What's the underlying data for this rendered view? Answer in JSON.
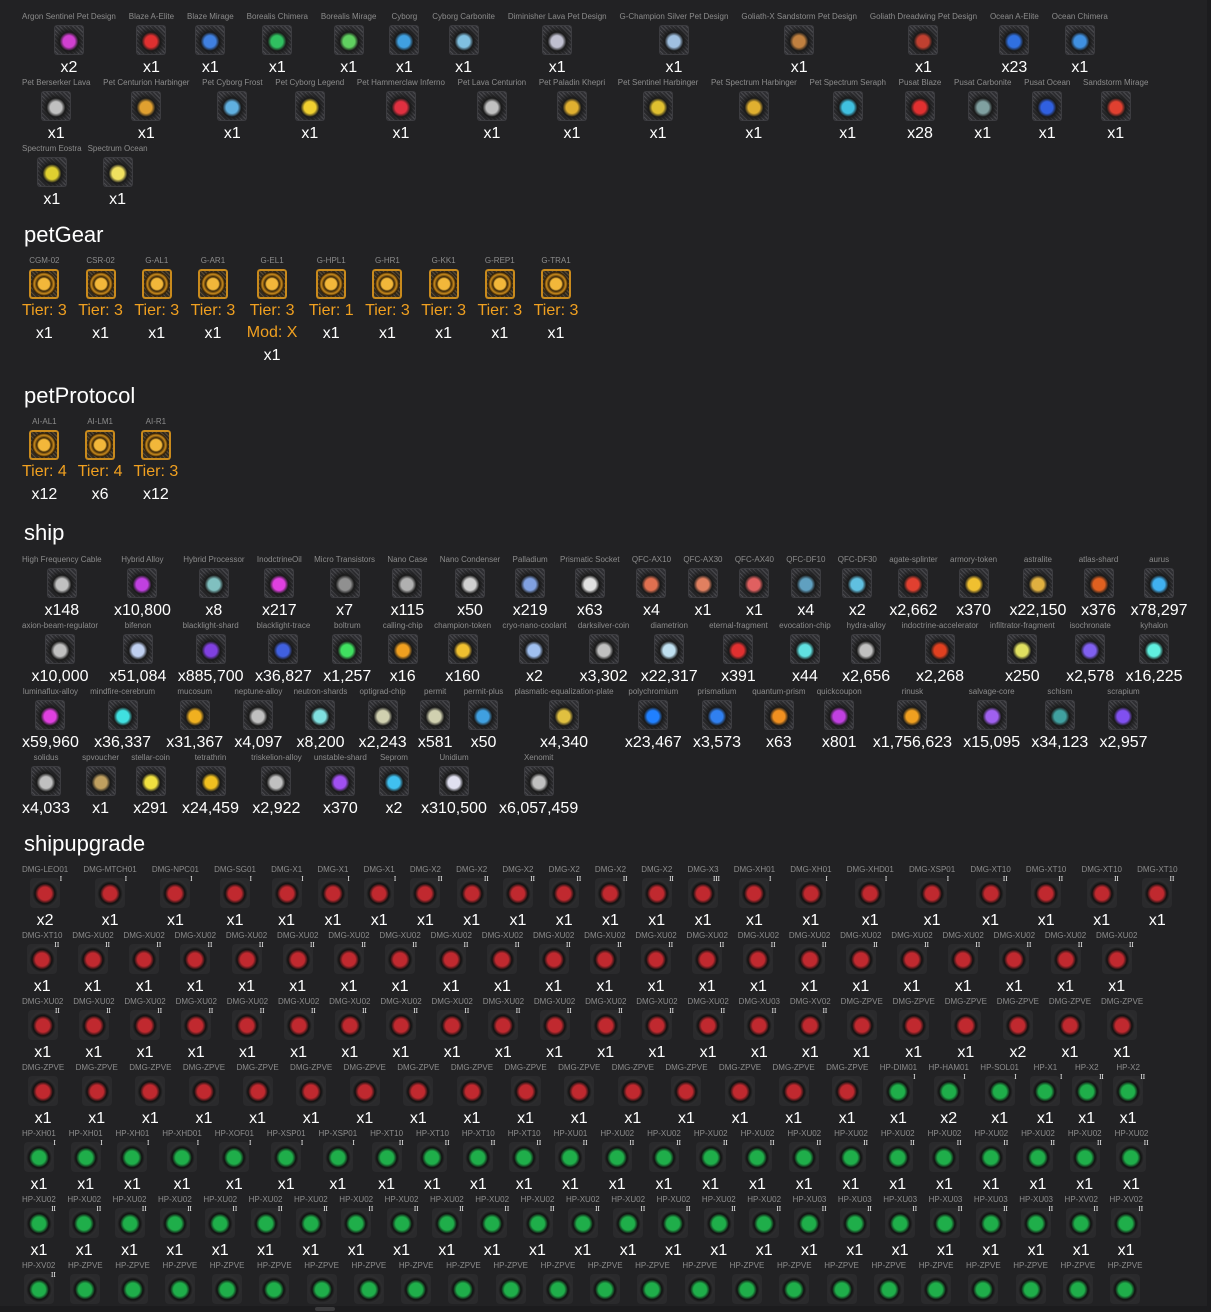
{
  "colors": {
    "background": "#222224",
    "text": "#ffffff",
    "label": "#8c8c8c",
    "tier": "#f0a020",
    "dmg": "#c0292f",
    "hp": "#1fae4a",
    "gear": "#f2b73a"
  },
  "headings": {
    "petGear": "petGear",
    "petProtocol": "petProtocol",
    "ship": "ship",
    "shipupgrade": "shipupgrade"
  },
  "pet_designs": [
    [
      [
        "Argon Sentinel Pet Design",
        "x2"
      ],
      [
        "Blaze A-Elite",
        "x1"
      ],
      [
        "Blaze Mirage",
        "x1"
      ],
      [
        "Borealis Chimera",
        "x1"
      ],
      [
        "Borealis Mirage",
        "x1"
      ],
      [
        "Cyborg",
        "x1"
      ],
      [
        "Cyborg Carbonite",
        "x1"
      ],
      [
        "Diminisher Lava Pet Design",
        "x1"
      ],
      [
        "G-Champion Silver Pet Design",
        "x1"
      ],
      [
        "Goliath-X Sandstorm Pet Design",
        "x1"
      ],
      [
        "Goliath Dreadwing Pet Design",
        "x1"
      ],
      [
        "Ocean A-Elite",
        "x23"
      ],
      [
        "Ocean Chimera",
        "x1"
      ]
    ],
    [
      [
        "Pet Berserker Lava",
        "x1"
      ],
      [
        "Pet Centurion Harbinger",
        "x1"
      ],
      [
        "Pet Cyborg Frost",
        "x1"
      ],
      [
        "Pet Cyborg Legend",
        "x1"
      ],
      [
        "Pet Hammerclaw Inferno",
        "x1"
      ],
      [
        "Pet Lava Centurion",
        "x1"
      ],
      [
        "Pet Paladin Khepri",
        "x1"
      ],
      [
        "Pet Sentinel Harbinger",
        "x1"
      ],
      [
        "Pet Spectrum Harbinger",
        "x1"
      ],
      [
        "Pet Spectrum Seraph",
        "x1"
      ],
      [
        "Pusat Blaze",
        "x28"
      ],
      [
        "Pusat Carbonite",
        "x1"
      ],
      [
        "Pusat Ocean",
        "x1"
      ],
      [
        "Sandstorm Mirage",
        "x1"
      ]
    ],
    [
      [
        "Spectrum Eostra",
        "x1"
      ],
      [
        "Spectrum Ocean",
        "x1"
      ]
    ]
  ],
  "pet_gear": [
    [
      "CGM-02",
      "Tier: 3",
      "x1"
    ],
    [
      "CSR-02",
      "Tier: 3",
      "x1"
    ],
    [
      "G-AL1",
      "Tier: 3",
      "x1"
    ],
    [
      "G-AR1",
      "Tier: 3",
      "x1"
    ],
    [
      "G-EL1",
      "Tier: 3",
      "Mod: X",
      "x1"
    ],
    [
      "G-HPL1",
      "Tier: 1",
      "x1"
    ],
    [
      "G-HR1",
      "Tier: 3",
      "x1"
    ],
    [
      "G-KK1",
      "Tier: 3",
      "x1"
    ],
    [
      "G-REP1",
      "Tier: 3",
      "x1"
    ],
    [
      "G-TRA1",
      "Tier: 3",
      "x1"
    ]
  ],
  "pet_protocol": [
    [
      "AI-AL1",
      "Tier: 4",
      "x12"
    ],
    [
      "AI-LM1",
      "Tier: 4",
      "x6"
    ],
    [
      "AI-R1",
      "Tier: 3",
      "x12"
    ]
  ],
  "ship": [
    [
      [
        "High Frequency Cable",
        "x148"
      ],
      [
        "Hybrid Alloy",
        "x10,800"
      ],
      [
        "Hybrid Processor",
        "x8"
      ],
      [
        "InodctrineOil",
        "x217"
      ],
      [
        "Micro Transistors",
        "x7"
      ],
      [
        "Nano Case",
        "x115"
      ],
      [
        "Nano Condenser",
        "x50"
      ],
      [
        "Palladium",
        "x219"
      ],
      [
        "Prismatic Socket",
        "x63"
      ],
      [
        "QFC-AX10",
        "x4"
      ],
      [
        "QFC-AX30",
        "x1"
      ],
      [
        "QFC-AX40",
        "x1"
      ],
      [
        "QFC-DF10",
        "x4"
      ],
      [
        "QFC-DF30",
        "x2"
      ],
      [
        "agate-splinter",
        "x2,662"
      ],
      [
        "armory-token",
        "x370"
      ],
      [
        "astralite",
        "x22,150"
      ],
      [
        "atlas-shard",
        "x376"
      ],
      [
        "aurus",
        "x78,297"
      ]
    ],
    [
      [
        "axion-beam-regulator",
        "x10,000"
      ],
      [
        "bifenon",
        "x51,084"
      ],
      [
        "blacklight-shard",
        "x885,700"
      ],
      [
        "blacklight-trace",
        "x36,827"
      ],
      [
        "boltrum",
        "x1,257"
      ],
      [
        "calling-chip",
        "x16"
      ],
      [
        "champion-token",
        "x160"
      ],
      [
        "cryo-nano-coolant",
        "x2"
      ],
      [
        "darksilver-coin",
        "x3,302"
      ],
      [
        "diametrion",
        "x22,317"
      ],
      [
        "eternal-fragment",
        "x391"
      ],
      [
        "evocation-chip",
        "x44"
      ],
      [
        "hydra-alloy",
        "x2,656"
      ],
      [
        "indoctrine-accelerator",
        "x2,268"
      ],
      [
        "infiltrator-fragment",
        "x250"
      ],
      [
        "isochronate",
        "x2,578"
      ],
      [
        "kyhalon",
        "x16,225"
      ]
    ],
    [
      [
        "luminaflux-alloy",
        "x59,960"
      ],
      [
        "mindfire-cerebrum",
        "x36,337"
      ],
      [
        "mucosum",
        "x31,367"
      ],
      [
        "neptune-alloy",
        "x4,097"
      ],
      [
        "neutron-shards",
        "x8,200"
      ],
      [
        "optigrad-chip",
        "x2,243"
      ],
      [
        "permit",
        "x581"
      ],
      [
        "permit-plus",
        "x50"
      ],
      [
        "plasmatic-equalization-plate",
        "x4,340"
      ],
      [
        "polychromium",
        "x23,467"
      ],
      [
        "prismatium",
        "x3,573"
      ],
      [
        "quantum-prism",
        "x63"
      ],
      [
        "quickcoupon",
        "x801"
      ],
      [
        "rinusk",
        "x1,756,623"
      ],
      [
        "salvage-core",
        "x15,095"
      ],
      [
        "schism",
        "x34,123"
      ],
      [
        "scrapium",
        "x2,957"
      ]
    ],
    [
      [
        "solidus",
        "x4,033"
      ],
      [
        "spvoucher",
        "x1"
      ],
      [
        "stellar-coin",
        "x291"
      ],
      [
        "tetrathrin",
        "x24,459"
      ],
      [
        "triskelion-alloy",
        "x2,922"
      ],
      [
        "unstable-shard",
        "x370"
      ],
      [
        "Seprom",
        "x2"
      ],
      [
        "Unidium",
        "x310,500"
      ],
      [
        "Xenomit",
        "x6,057,459"
      ]
    ]
  ],
  "shipupgrade": [
    [
      [
        "DMG-LEO01",
        "x2"
      ],
      [
        "DMG-MTCH01",
        "x1"
      ],
      [
        "DMG-NPC01",
        "x1"
      ],
      [
        "DMG-SG01",
        "x1"
      ],
      [
        "DMG-X1",
        "x1"
      ],
      [
        "DMG-X1",
        "x1"
      ],
      [
        "DMG-X1",
        "x1"
      ],
      [
        "DMG-X2",
        "x1"
      ],
      [
        "DMG-X2",
        "x1"
      ],
      [
        "DMG-X2",
        "x1"
      ],
      [
        "DMG-X2",
        "x1"
      ],
      [
        "DMG-X2",
        "x1"
      ],
      [
        "DMG-X2",
        "x1"
      ],
      [
        "DMG-X3",
        "x1"
      ],
      [
        "DMG-XH01",
        "x1"
      ],
      [
        "DMG-XH01",
        "x1"
      ],
      [
        "DMG-XHD01",
        "x1"
      ],
      [
        "DMG-XSP01",
        "x1"
      ],
      [
        "DMG-XT10",
        "x1"
      ],
      [
        "DMG-XT10",
        "x1"
      ],
      [
        "DMG-XT10",
        "x1"
      ],
      [
        "DMG-XT10",
        "x1"
      ]
    ],
    [
      [
        "DMG-XT10",
        "x1"
      ],
      [
        "DMG-XU02",
        "x1"
      ],
      [
        "DMG-XU02",
        "x1"
      ],
      [
        "DMG-XU02",
        "x1"
      ],
      [
        "DMG-XU02",
        "x1"
      ],
      [
        "DMG-XU02",
        "x1"
      ],
      [
        "DMG-XU02",
        "x1"
      ],
      [
        "DMG-XU02",
        "x1"
      ],
      [
        "DMG-XU02",
        "x1"
      ],
      [
        "DMG-XU02",
        "x1"
      ],
      [
        "DMG-XU02",
        "x1"
      ],
      [
        "DMG-XU02",
        "x1"
      ],
      [
        "DMG-XU02",
        "x1"
      ],
      [
        "DMG-XU02",
        "x1"
      ],
      [
        "DMG-XU02",
        "x1"
      ],
      [
        "DMG-XU02",
        "x1"
      ],
      [
        "DMG-XU02",
        "x1"
      ],
      [
        "DMG-XU02",
        "x1"
      ],
      [
        "DMG-XU02",
        "x1"
      ],
      [
        "DMG-XU02",
        "x1"
      ],
      [
        "DMG-XU02",
        "x1"
      ],
      [
        "DMG-XU02",
        "x1"
      ]
    ],
    [
      [
        "DMG-XU02",
        "x1"
      ],
      [
        "DMG-XU02",
        "x1"
      ],
      [
        "DMG-XU02",
        "x1"
      ],
      [
        "DMG-XU02",
        "x1"
      ],
      [
        "DMG-XU02",
        "x1"
      ],
      [
        "DMG-XU02",
        "x1"
      ],
      [
        "DMG-XU02",
        "x1"
      ],
      [
        "DMG-XU02",
        "x1"
      ],
      [
        "DMG-XU02",
        "x1"
      ],
      [
        "DMG-XU02",
        "x1"
      ],
      [
        "DMG-XU02",
        "x1"
      ],
      [
        "DMG-XU02",
        "x1"
      ],
      [
        "DMG-XU02",
        "x1"
      ],
      [
        "DMG-XU02",
        "x1"
      ],
      [
        "DMG-XU03",
        "x1"
      ],
      [
        "DMG-XV02",
        "x1"
      ],
      [
        "DMG-ZPVE",
        "x1"
      ],
      [
        "DMG-ZPVE",
        "x1"
      ],
      [
        "DMG-ZPVE",
        "x1"
      ],
      [
        "DMG-ZPVE",
        "x2"
      ],
      [
        "DMG-ZPVE",
        "x1"
      ],
      [
        "DMG-ZPVE",
        "x1"
      ]
    ],
    [
      [
        "DMG-ZPVE",
        "x1"
      ],
      [
        "DMG-ZPVE",
        "x1"
      ],
      [
        "DMG-ZPVE",
        "x1"
      ],
      [
        "DMG-ZPVE",
        "x1"
      ],
      [
        "DMG-ZPVE",
        "x1"
      ],
      [
        "DMG-ZPVE",
        "x1"
      ],
      [
        "DMG-ZPVE",
        "x1"
      ],
      [
        "DMG-ZPVE",
        "x1"
      ],
      [
        "DMG-ZPVE",
        "x1"
      ],
      [
        "DMG-ZPVE",
        "x1"
      ],
      [
        "DMG-ZPVE",
        "x1"
      ],
      [
        "DMG-ZPVE",
        "x1"
      ],
      [
        "DMG-ZPVE",
        "x1"
      ],
      [
        "DMG-ZPVE",
        "x1"
      ],
      [
        "DMG-ZPVE",
        "x1"
      ],
      [
        "DMG-ZPVE",
        "x1"
      ],
      [
        "HP-DIM01",
        "x1"
      ],
      [
        "HP-HAM01",
        "x2"
      ],
      [
        "HP-SOL01",
        "x1"
      ],
      [
        "HP-X1",
        "x1"
      ],
      [
        "HP-X2",
        "x1"
      ],
      [
        "HP-X2",
        "x1"
      ]
    ],
    [
      [
        "HP-XH01",
        "x1"
      ],
      [
        "HP-XH01",
        "x1"
      ],
      [
        "HP-XH01",
        "x1"
      ],
      [
        "HP-XHD01",
        "x1"
      ],
      [
        "HP-XOF01",
        "x1"
      ],
      [
        "HP-XSP01",
        "x1"
      ],
      [
        "HP-XSP01",
        "x1"
      ],
      [
        "HP-XT10",
        "x1"
      ],
      [
        "HP-XT10",
        "x1"
      ],
      [
        "HP-XT10",
        "x1"
      ],
      [
        "HP-XT10",
        "x1"
      ],
      [
        "HP-XU01",
        "x1"
      ],
      [
        "HP-XU02",
        "x1"
      ],
      [
        "HP-XU02",
        "x1"
      ],
      [
        "HP-XU02",
        "x1"
      ],
      [
        "HP-XU02",
        "x1"
      ],
      [
        "HP-XU02",
        "x1"
      ],
      [
        "HP-XU02",
        "x1"
      ],
      [
        "HP-XU02",
        "x1"
      ],
      [
        "HP-XU02",
        "x1"
      ],
      [
        "HP-XU02",
        "x1"
      ],
      [
        "HP-XU02",
        "x1"
      ],
      [
        "HP-XU02",
        "x1"
      ],
      [
        "HP-XU02",
        "x1"
      ]
    ],
    [
      [
        "HP-XU02",
        "x1"
      ],
      [
        "HP-XU02",
        "x1"
      ],
      [
        "HP-XU02",
        "x1"
      ],
      [
        "HP-XU02",
        "x1"
      ],
      [
        "HP-XU02",
        "x1"
      ],
      [
        "HP-XU02",
        "x1"
      ],
      [
        "HP-XU02",
        "x1"
      ],
      [
        "HP-XU02",
        "x1"
      ],
      [
        "HP-XU02",
        "x1"
      ],
      [
        "HP-XU02",
        "x1"
      ],
      [
        "HP-XU02",
        "x1"
      ],
      [
        "HP-XU02",
        "x1"
      ],
      [
        "HP-XU02",
        "x1"
      ],
      [
        "HP-XU02",
        "x1"
      ],
      [
        "HP-XU02",
        "x1"
      ],
      [
        "HP-XU02",
        "x1"
      ],
      [
        "HP-XU02",
        "x1"
      ],
      [
        "HP-XU03",
        "x1"
      ],
      [
        "HP-XU03",
        "x1"
      ],
      [
        "HP-XU03",
        "x1"
      ],
      [
        "HP-XU03",
        "x1"
      ],
      [
        "HP-XU03",
        "x1"
      ],
      [
        "HP-XU03",
        "x1"
      ],
      [
        "HP-XV02",
        "x1"
      ],
      [
        "HP-XV02",
        "x1"
      ]
    ],
    [
      [
        "HP-XV02",
        ""
      ],
      [
        "HP-ZPVE",
        ""
      ],
      [
        "HP-ZPVE",
        ""
      ],
      [
        "HP-ZPVE",
        ""
      ],
      [
        "HP-ZPVE",
        ""
      ],
      [
        "HP-ZPVE",
        ""
      ],
      [
        "HP-ZPVE",
        ""
      ],
      [
        "HP-ZPVE",
        ""
      ],
      [
        "HP-ZPVE",
        ""
      ],
      [
        "HP-ZPVE",
        ""
      ],
      [
        "HP-ZPVE",
        ""
      ],
      [
        "HP-ZPVE",
        ""
      ],
      [
        "HP-ZPVE",
        ""
      ],
      [
        "HP-ZPVE",
        ""
      ],
      [
        "HP-ZPVE",
        ""
      ],
      [
        "HP-ZPVE",
        ""
      ],
      [
        "HP-ZPVE",
        ""
      ],
      [
        "HP-ZPVE",
        ""
      ],
      [
        "HP-ZPVE",
        ""
      ],
      [
        "HP-ZPVE",
        ""
      ],
      [
        "HP-ZPVE",
        ""
      ],
      [
        "HP-ZPVE",
        ""
      ],
      [
        "HP-ZPVE",
        ""
      ],
      [
        "HP-ZPVE",
        ""
      ]
    ]
  ]
}
